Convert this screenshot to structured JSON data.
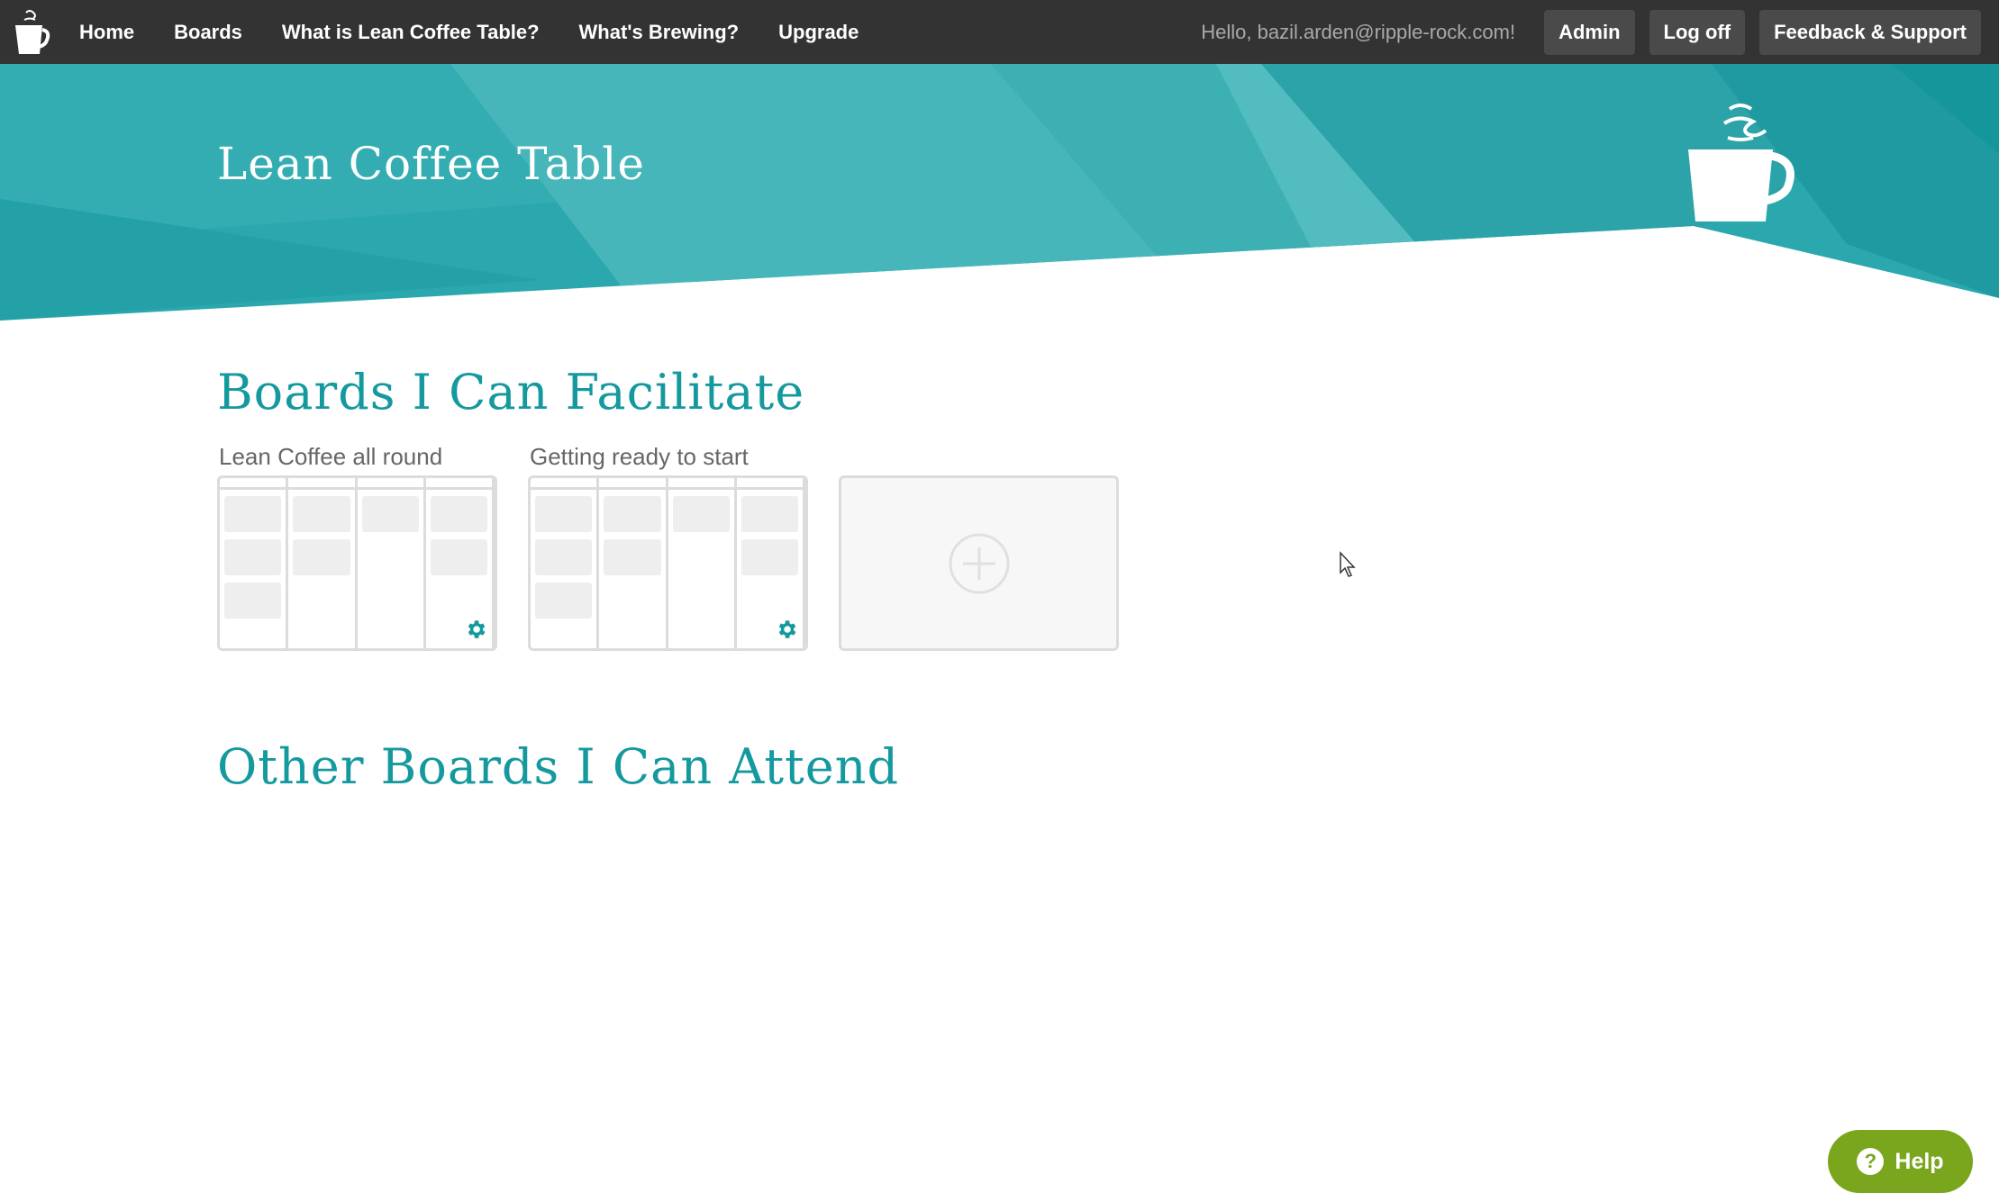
{
  "nav": {
    "links": [
      "Home",
      "Boards",
      "What is Lean Coffee Table?",
      "What's Brewing?",
      "Upgrade"
    ],
    "greeting": "Hello, bazil.arden@ripple-rock.com!",
    "admin_label": "Admin",
    "logoff_label": "Log off",
    "feedback_label": "Feedback & Support"
  },
  "hero": {
    "title": "Lean Coffee Table"
  },
  "sections": {
    "facilitate_title": "Boards I Can Facilitate",
    "attend_title": "Other Boards I Can Attend"
  },
  "boards": [
    {
      "name": "Lean Coffee all round"
    },
    {
      "name": "Getting ready to start"
    }
  ],
  "help": {
    "label": "Help"
  },
  "colors": {
    "nav_bg": "#333333",
    "teal": "#14999e",
    "hero_teal": "#2aa8ad",
    "help_green": "#7aa61e"
  }
}
